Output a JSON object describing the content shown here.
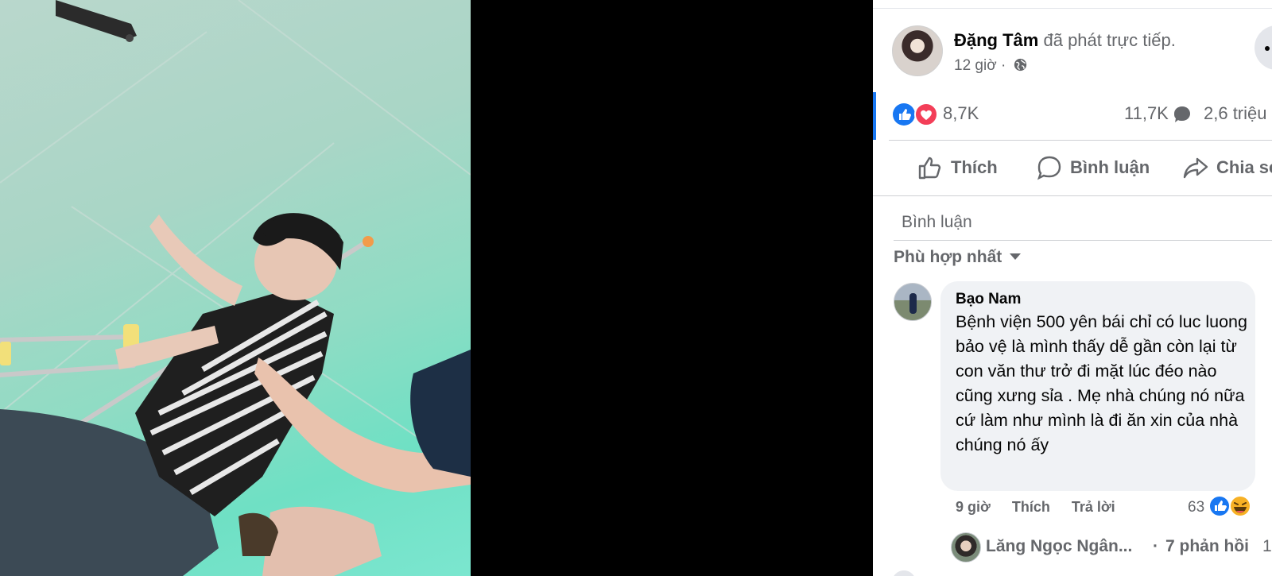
{
  "post": {
    "author": "Đặng Tâm",
    "action": "đã phát trực tiếp.",
    "time": "12 giờ ·",
    "audience_icon": "globe-icon"
  },
  "stats": {
    "reactions": "8,7K",
    "comments": "11,7K",
    "views": "2,6 triệu"
  },
  "actions": {
    "like": "Thích",
    "comment": "Bình luận",
    "share": "Chia sẻ"
  },
  "comment_box": {
    "placeholder": "Bình luận"
  },
  "sort": {
    "label": "Phù hợp nhất"
  },
  "comments": [
    {
      "name": "Bạo Nam",
      "text": "Bệnh viện 500 yên bái chỉ có luc luong bảo vệ là mình thấy dễ gần còn lại từ con văn thư trở đi mặt lúc đéo nào cũng xưng sỉa . Mẹ nhà chúng nó nữa cứ làm như mình là đi ăn xin của nhà chúng nó ấy",
      "time": "9 giờ",
      "like": "Thích",
      "reply": "Trả lời",
      "reactions": "63",
      "replies": {
        "first_replier": "Lăng Ngọc Ngân...",
        "separator": "·",
        "count": "7 phản hồi",
        "extra": "1"
      }
    }
  ],
  "colors": {
    "accent": "#1877f2",
    "love": "#f33e58",
    "muted_text": "#65676b",
    "bubble_bg": "#f0f2f5"
  }
}
